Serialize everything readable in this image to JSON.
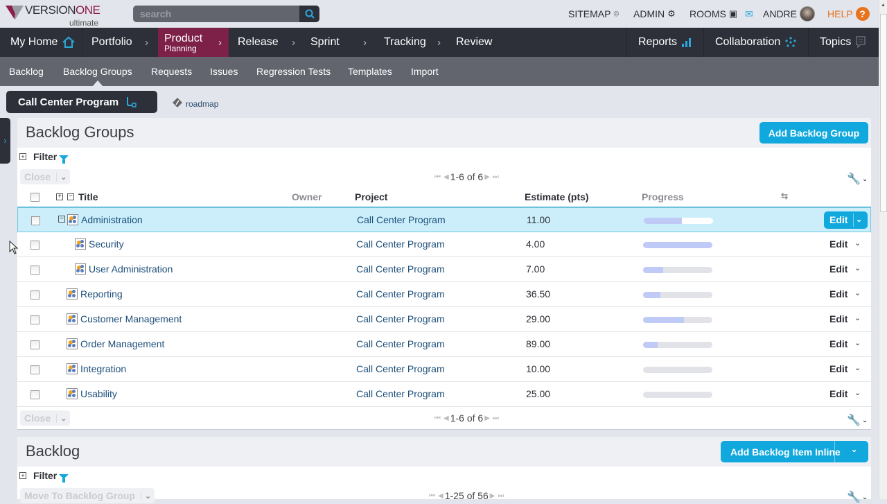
{
  "app": {
    "logo_brand": "VERSION",
    "logo_brand_accent": "ONE",
    "logo_edition": "ultimate",
    "search_placeholder": "search"
  },
  "utility_nav": {
    "sitemap": "SITEMAP",
    "admin": "ADMIN",
    "rooms": "ROOMS",
    "user": "ANDRE",
    "help": "HELP",
    "help_icon": "?"
  },
  "main_nav": {
    "my_home": "My Home",
    "portfolio": "Portfolio",
    "product": "Product",
    "product_sub": "Planning",
    "release": "Release",
    "sprint": "Sprint",
    "tracking": "Tracking",
    "review": "Review",
    "reports": "Reports",
    "collaboration": "Collaboration",
    "topics": "Topics",
    "active": "Product Planning"
  },
  "sub_nav": {
    "items": [
      "Backlog",
      "Backlog Groups",
      "Requests",
      "Issues",
      "Regression Tests",
      "Templates",
      "Import"
    ],
    "active": "Backlog Groups"
  },
  "context": {
    "project": "Call Center Program",
    "roadmap_link": "roadmap"
  },
  "backlog_groups": {
    "title": "Backlog Groups",
    "add_button": "Add Backlog Group",
    "filter_label": "Filter",
    "close_label": "Close",
    "pager": "1-6 of 6",
    "columns": {
      "title": "Title",
      "owner": "Owner",
      "project": "Project",
      "estimate": "Estimate (pts)",
      "progress": "Progress"
    },
    "edit_label": "Edit",
    "rows": [
      {
        "title": "Administration",
        "project": "Call Center Program",
        "estimate": "11.00",
        "progress": 0.55,
        "level": 0,
        "expandable": true,
        "selected": true
      },
      {
        "title": "Security",
        "project": "Call Center Program",
        "estimate": "4.00",
        "progress": 1.0,
        "level": 1,
        "expandable": false,
        "selected": false
      },
      {
        "title": "User Administration",
        "project": "Call Center Program",
        "estimate": "7.00",
        "progress": 0.29,
        "level": 1,
        "expandable": false,
        "selected": false
      },
      {
        "title": "Reporting",
        "project": "Call Center Program",
        "estimate": "36.50",
        "progress": 0.25,
        "level": 0,
        "expandable": false,
        "selected": false
      },
      {
        "title": "Customer Management",
        "project": "Call Center Program",
        "estimate": "29.00",
        "progress": 0.59,
        "level": 0,
        "expandable": false,
        "selected": false
      },
      {
        "title": "Order Management",
        "project": "Call Center Program",
        "estimate": "89.00",
        "progress": 0.21,
        "level": 0,
        "expandable": false,
        "selected": false
      },
      {
        "title": "Integration",
        "project": "Call Center Program",
        "estimate": "10.00",
        "progress": 0.0,
        "level": 0,
        "expandable": false,
        "selected": false
      },
      {
        "title": "Usability",
        "project": "Call Center Program",
        "estimate": "25.00",
        "progress": 0.0,
        "level": 0,
        "expandable": false,
        "selected": false
      }
    ]
  },
  "backlog": {
    "title": "Backlog",
    "add_button": "Add Backlog Item Inline",
    "filter_label": "Filter",
    "move_label": "Move To Backlog Group",
    "pager": "1-25 of 56"
  },
  "colors": {
    "brand": "#8b1e4a",
    "accent": "#11a8dd",
    "nav_bg": "#2d3039",
    "active_nav": "#7d2149",
    "help": "#e8731f",
    "progress_fill": "#bfcaf6"
  }
}
